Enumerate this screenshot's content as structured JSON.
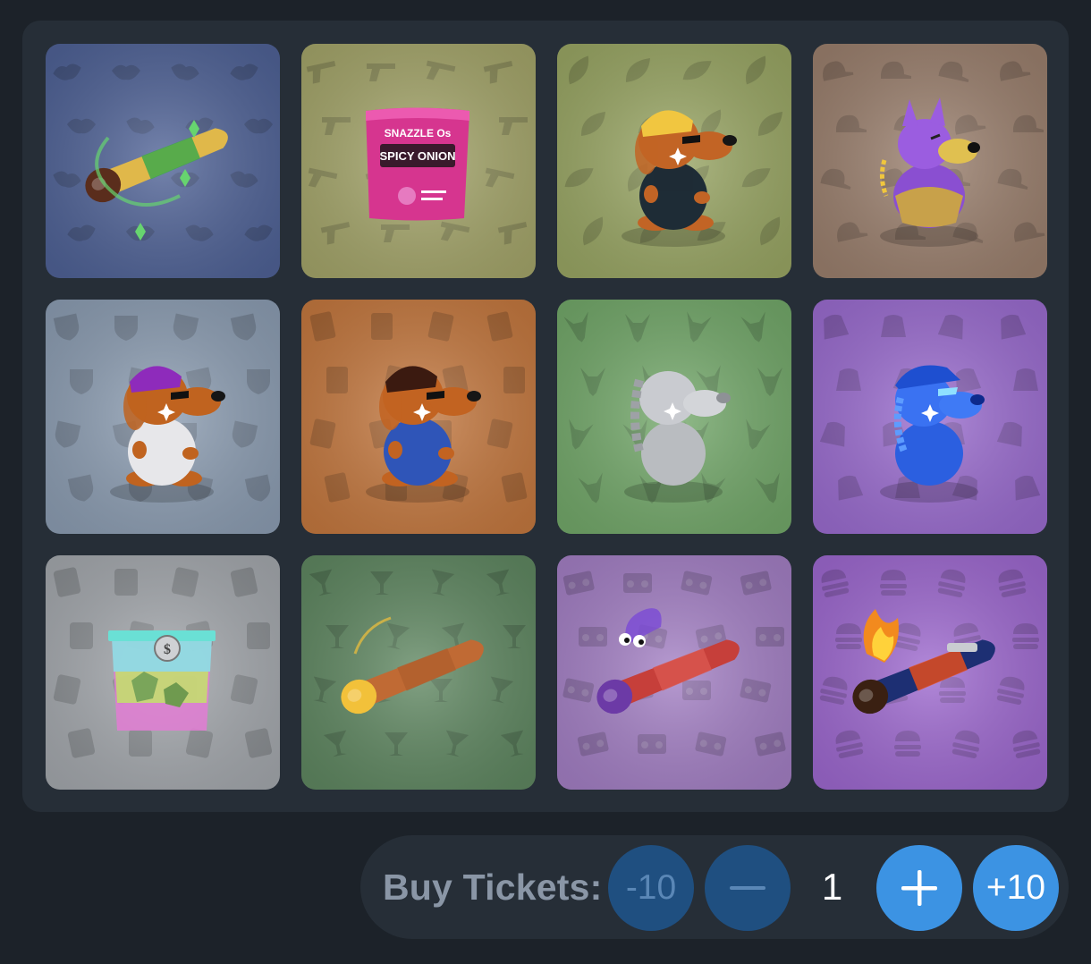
{
  "theme": {
    "background": "#1c2229",
    "panel": "#262e37",
    "button_active": "#3c93e3",
    "button_disabled": "#1f4f80",
    "label_color": "#8a96a6"
  },
  "grid": {
    "items": [
      {
        "name": "rainbow-joint-item",
        "bg": "#4f6296",
        "pattern": "lips"
      },
      {
        "name": "spicy-onion-snack-bag-item",
        "bg": "#a4a56a",
        "pattern": "pistol"
      },
      {
        "name": "dog-with-sunglasses-item",
        "bg": "#99a664",
        "pattern": "leaf"
      },
      {
        "name": "purple-doberman-item",
        "bg": "#9a7f6d",
        "pattern": "cap"
      },
      {
        "name": "dog-purple-bandana-item",
        "bg": "#8c9db2",
        "pattern": "shield"
      },
      {
        "name": "dog-braids-sunglasses-item",
        "bg": "#c4783f",
        "pattern": "rune"
      },
      {
        "name": "silver-dog-item",
        "bg": "#73a86a",
        "pattern": "goat"
      },
      {
        "name": "blue-dog-item",
        "bg": "#9a6ccf",
        "pattern": "hat"
      },
      {
        "name": "rainbow-money-bag-item",
        "bg": "#a4a8ad",
        "pattern": "frame"
      },
      {
        "name": "golden-joint-item",
        "bg": "#5f8761",
        "pattern": "glass"
      },
      {
        "name": "spooky-joint-item",
        "bg": "#a37fc4",
        "pattern": "boombox"
      },
      {
        "name": "flame-joint-item",
        "bg": "#9d68cf",
        "pattern": "burger"
      }
    ],
    "snack_bag": {
      "brand": "SNAZZLE Os",
      "flavor": "SPICY ONION"
    },
    "money_bag": {
      "coin_symbol": "$"
    }
  },
  "ticket_bar": {
    "label": "Buy Tickets:",
    "minus_ten_label": "-10",
    "plus_ten_label": "+10",
    "quantity": "1",
    "minus_icon": "minus-icon",
    "plus_icon": "plus-icon"
  }
}
